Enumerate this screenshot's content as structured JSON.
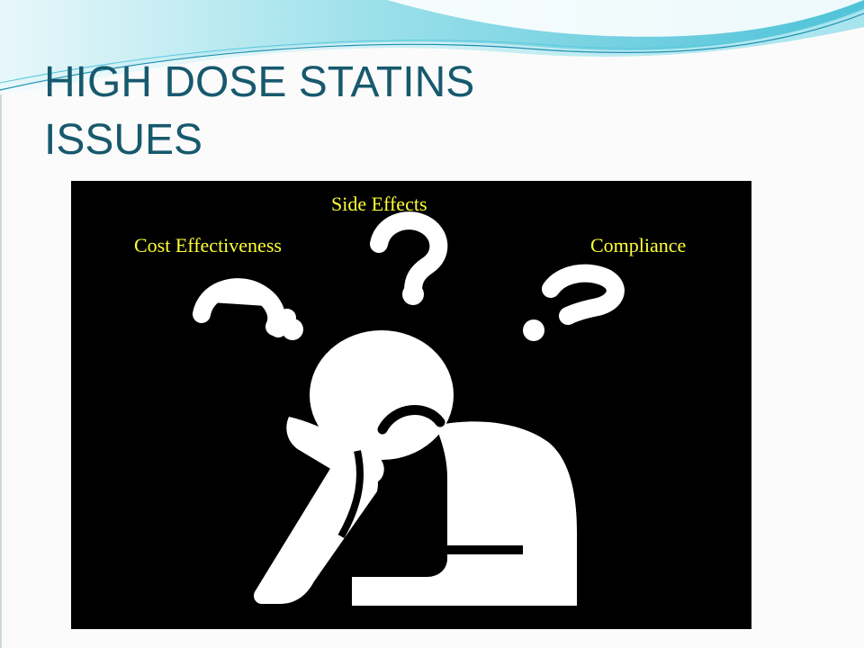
{
  "slide": {
    "title_line1": "HIGH DOSE STATINS",
    "title_line2": "ISSUES"
  },
  "picture": {
    "icon": "thinking-person-with-question-marks",
    "labels": {
      "side_effects": "Side Effects",
      "cost_effectiveness": "Cost Effectiveness",
      "compliance": "Compliance"
    },
    "colors": {
      "background": "#000000",
      "label": "#ffff33",
      "figure": "#ffffff"
    }
  },
  "theme": {
    "title_color": "#17596e",
    "wave_color": "#4fc3d9"
  }
}
